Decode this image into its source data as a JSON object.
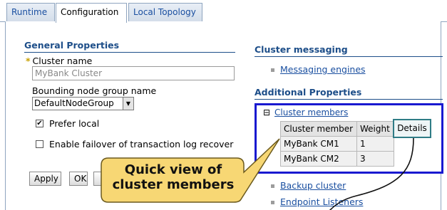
{
  "tabs": [
    {
      "label": "Runtime",
      "active": false
    },
    {
      "label": "Configuration",
      "active": true
    },
    {
      "label": "Local Topology",
      "active": false
    }
  ],
  "general": {
    "heading": "General Properties",
    "cluster_name_label": "Cluster name",
    "cluster_name_value": "MyBank Cluster",
    "bounding_label": "Bounding node group name",
    "bounding_value": "DefaultNodeGroup",
    "prefer_local_label": "Prefer local",
    "prefer_local_checked": true,
    "failover_label": "Enable failover of transaction log recover",
    "failover_checked": false
  },
  "buttons": {
    "apply": "Apply",
    "ok": "OK"
  },
  "messaging": {
    "heading": "Cluster messaging",
    "engines_link": "Messaging engines"
  },
  "additional": {
    "heading": "Additional Properties",
    "toggle_symbol": "⊟",
    "members_link": "Cluster members",
    "table": {
      "headers": [
        "Cluster member",
        "Weight"
      ],
      "rows": [
        [
          "MyBank CM1",
          "1"
        ],
        [
          "MyBank CM2",
          "3"
        ]
      ]
    },
    "details_button": "Details",
    "backup_link": "Backup cluster",
    "endpoint_link": "Endpoint Listeners"
  },
  "callout": {
    "line1": "Quick view of",
    "line2": "cluster members"
  },
  "colors": {
    "highlight_border": "#1919d0",
    "callout_fill": "#f7d774",
    "link": "#1a4fa0",
    "heading": "#1d4e89"
  }
}
